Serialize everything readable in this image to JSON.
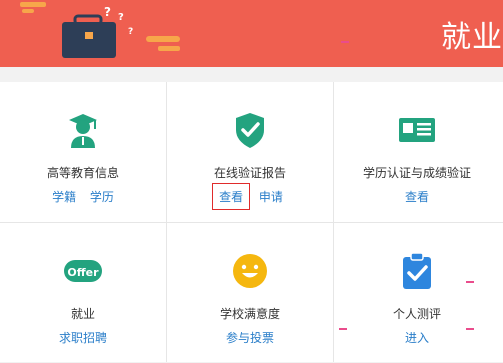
{
  "banner": {
    "title": "就业",
    "color": "#ef5f50"
  },
  "services": [
    {
      "icon": "graduate-icon",
      "title": "高等教育信息",
      "links": [
        "学籍",
        "学历"
      ]
    },
    {
      "icon": "shield-check-icon",
      "title": "在线验证报告",
      "links": [
        "查看",
        "申请"
      ],
      "highlighted_link": "查看"
    },
    {
      "icon": "id-card-icon",
      "title": "学历认证与成绩验证",
      "links": [
        "查看"
      ]
    },
    {
      "icon": "offer-badge-icon",
      "icon_text": "Offer",
      "title": "就业",
      "links": [
        "求职招聘"
      ]
    },
    {
      "icon": "smiley-face-icon",
      "title": "学校满意度",
      "links": [
        "参与投票"
      ]
    },
    {
      "icon": "clipboard-check-icon",
      "title": "个人测评",
      "links": [
        "进入"
      ]
    }
  ],
  "colors": {
    "accent": "#2a7ec9",
    "icon_green": "#23a37f",
    "icon_yellow": "#f5b70f",
    "icon_blue": "#2e86de",
    "highlight_box": "#e02b2b"
  }
}
